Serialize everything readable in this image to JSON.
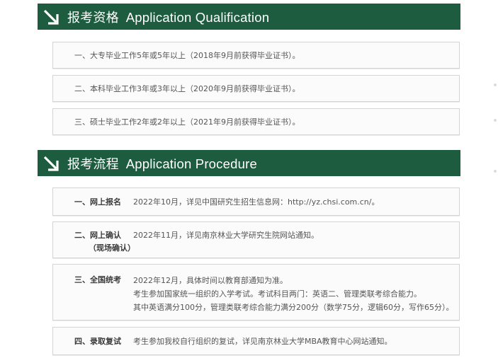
{
  "qualification": {
    "title_cn": "报考资格",
    "title_en": "Application Qualification",
    "items": [
      "一、大专毕业工作5年或5年以上（2018年9月前获得毕业证书）。",
      "二、本科毕业工作3年或3年以上（2020年9月前获得毕业证书）。",
      "三、硕士毕业工作2年或2年以上（2021年9月前获得毕业证书）。"
    ]
  },
  "procedure": {
    "title_cn": "报考流程",
    "title_en": "Application Procedure",
    "steps": [
      {
        "label": "一、网上报名",
        "sublabel": "",
        "lines": [
          "2022年10月，详见中国研究生招生信息网：http://yz.chsi.com.cn/。"
        ]
      },
      {
        "label": "二、网上确认",
        "sublabel": "（现场确认）",
        "lines": [
          "2022年11月，详见南京林业大学研究生院网站通知。"
        ]
      },
      {
        "label": "三、全国统考",
        "sublabel": "",
        "lines": [
          "2022年12月，具体时间以教育部通知为准。",
          "考生参加国家统一组织的入学考试。考试科目两门：英语二、管理类联考综合能力。",
          "其中英语满分100分，管理类联考综合能力满分200分（数学75分，逻辑60分，写作65分）。"
        ]
      },
      {
        "label": "四、录取复试",
        "sublabel": "",
        "lines": [
          "考生参加我校自行组织的复试，详见南京林业大学MBA教育中心网站通知。"
        ]
      }
    ]
  },
  "colors": {
    "banner": "#1e5c3f",
    "text": "#555555"
  }
}
